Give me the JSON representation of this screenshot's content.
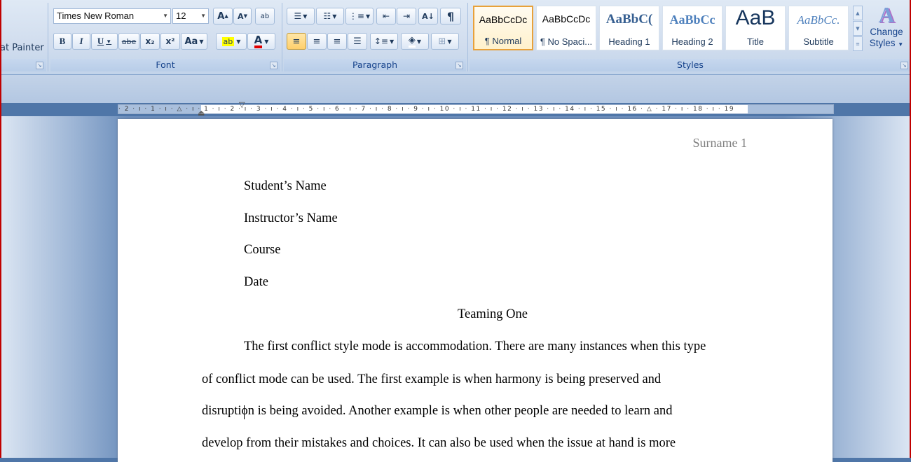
{
  "ribbon": {
    "clipboard": {
      "format_painter_label": "at Painter"
    },
    "font": {
      "group_label": "Font",
      "font_name": "Times New Roman",
      "font_size": "12",
      "grow_font": "A",
      "shrink_font": "A",
      "clear_format": "ab",
      "bold": "B",
      "italic": "I",
      "underline": "U",
      "strikethrough": "abe",
      "subscript": "x₂",
      "superscript": "x²",
      "change_case": "Aa",
      "highlight": "ab",
      "font_color": "A"
    },
    "paragraph": {
      "group_label": "Paragraph",
      "show_hide": "¶"
    },
    "styles": {
      "group_label": "Styles",
      "tiles": [
        {
          "preview": "AaBbCcDc",
          "name": "¶ Normal"
        },
        {
          "preview": "AaBbCcDc",
          "name": "¶ No Spaci..."
        },
        {
          "preview": "AaBbC(",
          "name": "Heading 1"
        },
        {
          "preview": "AaBbCc",
          "name": "Heading 2"
        },
        {
          "preview": "AaB",
          "name": "Title"
        },
        {
          "preview": "AaBbCc.",
          "name": "Subtitle"
        }
      ],
      "change_styles_line1": "Change",
      "change_styles_line2": "Styles"
    }
  },
  "ruler": {
    "ticks": "· 2 · ı · 1 · ı · △ · ı · 1 · ı · 2 · ı · 3 · ı · 4 · ı · 5 · ı · 6 · ı · 7 · ı · 8 · ı · 9 · ı · 10 · ı · 11 · ı · 12 · ı · 13 · ı · 14 · ı · 15 · ı · 16 · △ · 17 · ı · 18 · ı · 19"
  },
  "document": {
    "header": "Surname 1",
    "student_name": "Student’s Name",
    "instructor_name": "Instructor’s Name",
    "course": "Course",
    "date": "Date",
    "title": "Teaming One",
    "body_lines": [
      "The first conflict style mode is accommodation. There are many instances when this type",
      "of conflict mode can be used. The first example is when harmony is being preserved and",
      "disruption is being avoided. Another example is when other people are needed to learn and",
      "develop from their mistakes and choices. It can also be used when the issue at hand is more"
    ]
  },
  "colors": {
    "highlight_yellow": "#ffff00",
    "font_color_red": "#e00000",
    "active_style_border": "#e8a13a",
    "group_label_text": "#15428b"
  }
}
